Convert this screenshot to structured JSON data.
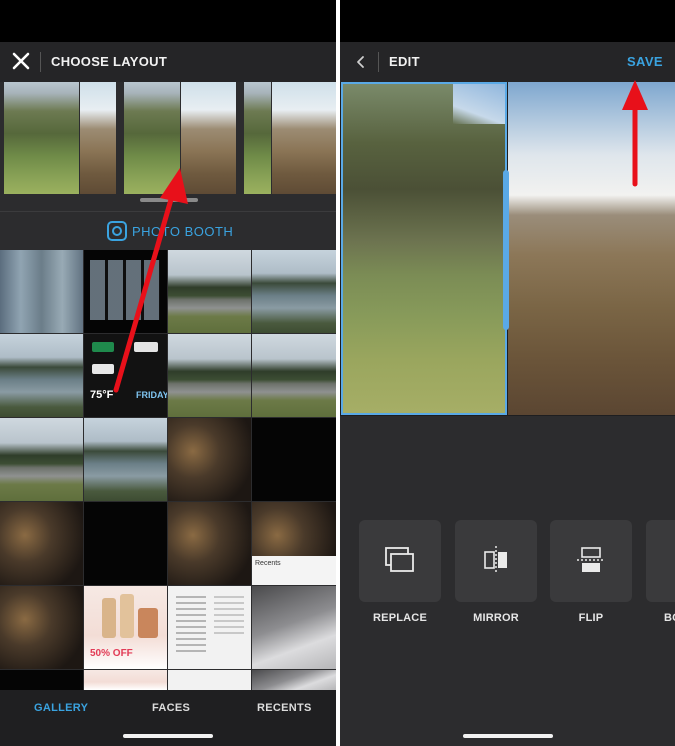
{
  "left_screen": {
    "header": {
      "title": "CHOOSE LAYOUT"
    },
    "photo_booth": {
      "label": "PHOTO BOOTH"
    },
    "tile_texts": {
      "temperature": "75°F",
      "day": "FRIDAY",
      "promo": "50% OFF",
      "recents": "Recents"
    },
    "tabs": [
      {
        "label": "GALLERY",
        "active": true
      },
      {
        "label": "FACES",
        "active": false
      },
      {
        "label": "RECENTS",
        "active": false
      }
    ]
  },
  "right_screen": {
    "header": {
      "title": "EDIT",
      "save_label": "SAVE"
    },
    "tools": [
      {
        "label": "REPLACE",
        "icon": "replace-icon"
      },
      {
        "label": "MIRROR",
        "icon": "mirror-icon"
      },
      {
        "label": "FLIP",
        "icon": "flip-icon"
      },
      {
        "label": "BO",
        "icon": "border-icon"
      }
    ]
  },
  "colors": {
    "accent": "#3aa3e0",
    "annotation_arrow": "#e8101a",
    "background": "#2c2c2e"
  }
}
